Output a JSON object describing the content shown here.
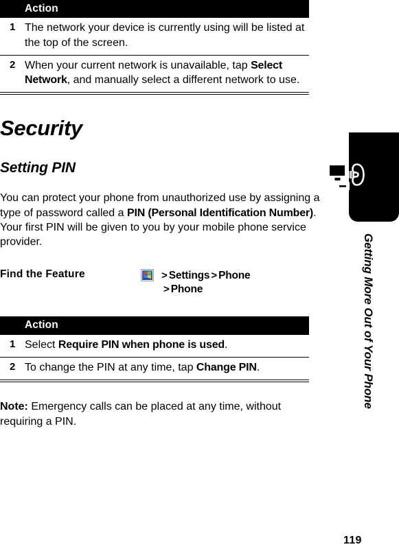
{
  "page": {
    "number": "119",
    "running_head": "Getting More Out of Your Phone"
  },
  "table_network": {
    "header": "Action",
    "rows": [
      {
        "num": "1",
        "text_before": "The network your device is currently using will be listed at the top of the screen.",
        "ui_string": "",
        "text_after": ""
      },
      {
        "num": "2",
        "text_before": "When your current network is unavailable, tap ",
        "ui_string": "Select Network",
        "text_after": ", and manually select a different network to use."
      }
    ]
  },
  "chapter_heading": "Security",
  "section_heading": "Setting PIN",
  "intro_paragraph": {
    "part1": "You can protect your phone from unauthorized use by assigning a type of password called a ",
    "ui_string": "PIN (Personal Identification Number)",
    "part2": ". Your first PIN will be given to you by your mobile phone service provider."
  },
  "find_the_feature": {
    "label": "Find the Feature",
    "icon": "windows-start-icon",
    "separator": ">",
    "path_line1": [
      "Settings",
      "Phone"
    ],
    "path_line2": [
      "Phone"
    ]
  },
  "table_pin": {
    "header": "Action",
    "rows": [
      {
        "num": "1",
        "text_before": "Select ",
        "ui_string": "Require PIN when phone is used",
        "text_after": "."
      },
      {
        "num": "2",
        "text_before": "To change the PIN at any time, tap ",
        "ui_string": "Change PIN",
        "text_after": "."
      }
    ]
  },
  "note": {
    "label": "Note:",
    "text": " Emergency calls can be placed at any time, without requiring a PIN."
  },
  "colors": {
    "header_bar": "#000000",
    "header_text": "#ffffff",
    "body_text": "#000000",
    "icon_blue": "#2f6fd0"
  }
}
